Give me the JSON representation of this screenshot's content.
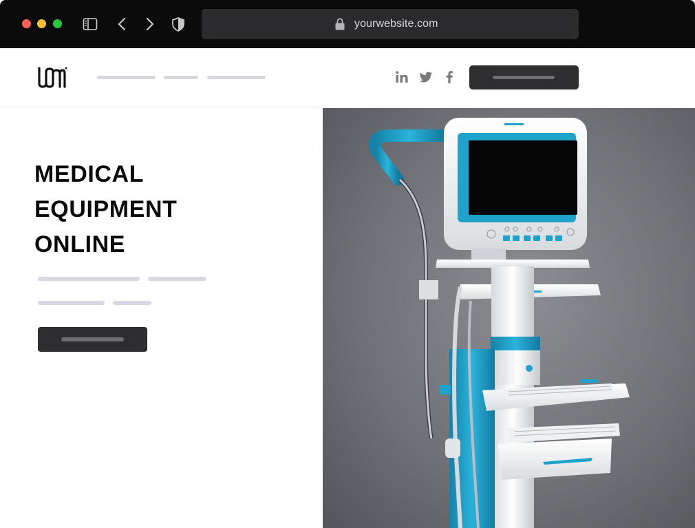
{
  "browser": {
    "url": "yourwebsite.com",
    "window_controls": [
      "close",
      "minimize",
      "maximize"
    ],
    "toolbar_icons": [
      "sidebar-icon",
      "back-icon",
      "forward-icon",
      "shield-icon"
    ]
  },
  "header": {
    "logo_alt": "logo",
    "social": [
      "linkedin-icon",
      "twitter-icon",
      "facebook-icon"
    ]
  },
  "hero": {
    "title_lines": [
      "MEDICAL",
      "EQUIPMENT",
      "ONLINE"
    ],
    "image_subject": "medical monitor cart"
  },
  "colors": {
    "chrome": "#0b0b0c",
    "url_field": "#2b2b2d",
    "button": "#2e2e30",
    "placeholder_line": "#d9d9e3",
    "accent_teal": "#1fa3cc"
  }
}
